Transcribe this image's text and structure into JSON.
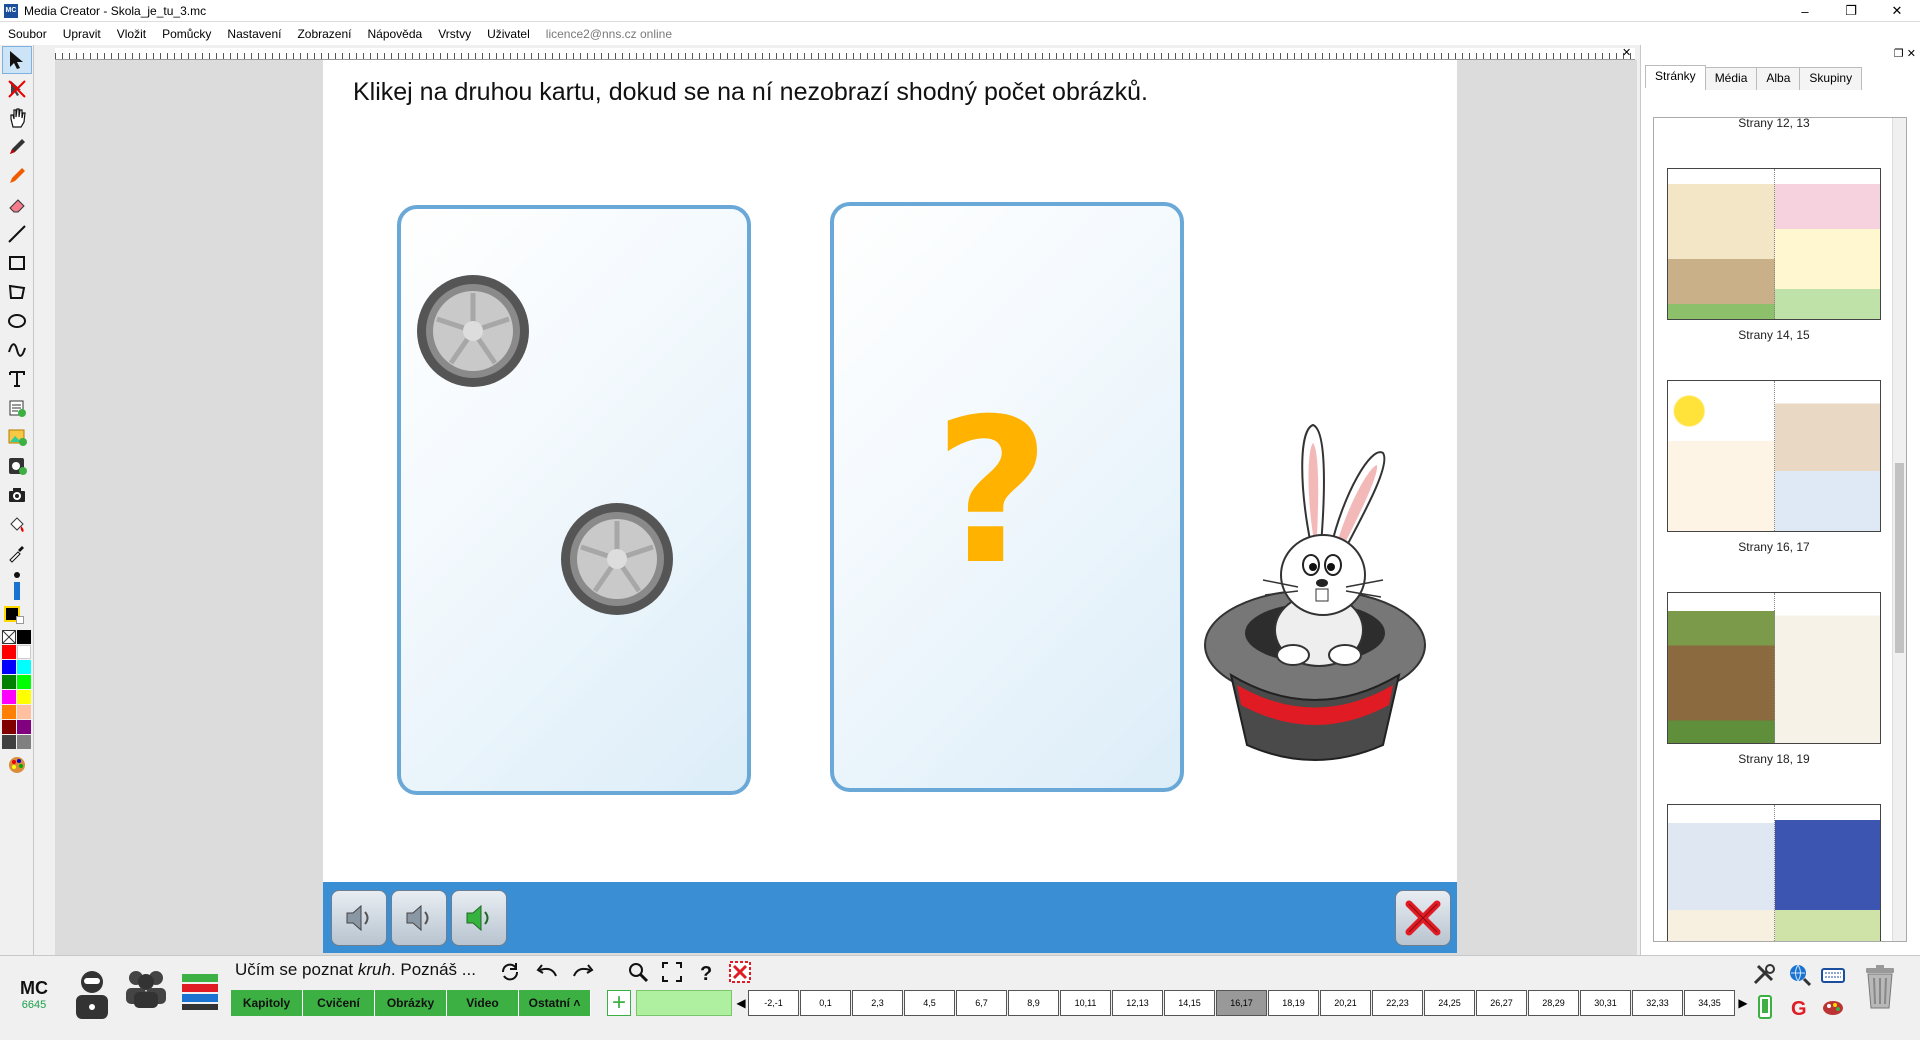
{
  "window": {
    "title": "Media Creator - Skola_je_tu_3.mc",
    "app_icon": "MC"
  },
  "menu": {
    "items": [
      "Soubor",
      "Upravit",
      "Vložit",
      "Pomůcky",
      "Nastavení",
      "Zobrazení",
      "Nápověda",
      "Vrstvy",
      "Uživatel"
    ],
    "user_status": "licence2@nns.cz online"
  },
  "toolbox": {
    "tools": [
      "select-arrow-icon",
      "no-select-icon",
      "hand-icon",
      "pen-icon",
      "highlighter-icon",
      "eraser-icon",
      "line-icon",
      "rectangle-icon",
      "polygon-icon",
      "ellipse-icon",
      "curve-icon",
      "text-icon",
      "note-icon",
      "image-icon",
      "media-icon",
      "camera-icon",
      "fill-icon",
      "eyedropper-icon"
    ],
    "palette": [
      "#000000",
      "#ffffff",
      "#ff0000",
      "#ffffff",
      "#0000ff",
      "#00ffff",
      "#008000",
      "#00ff00",
      "#ff00ff",
      "#ffff00",
      "#ff8000",
      "#ffc0a0",
      "#800000",
      "#800080",
      "#404040",
      "#808080"
    ],
    "current_color": "#000000",
    "accent_color": "#ffd800"
  },
  "page": {
    "instruction": "Klikej na druhou kartu, dokud se na ní nezobrazí shodný počet obrázků.",
    "question_mark": "?",
    "card_border": "#6aa8d8",
    "question_color": "#ffb300"
  },
  "panel": {
    "tabs": [
      "Stránky",
      "Média",
      "Alba",
      "Skupiny"
    ],
    "active_tab": "Stránky",
    "pages": [
      {
        "label": "Strany 12, 13"
      },
      {
        "label": "Strany 14, 15"
      },
      {
        "label": "Strany 16, 17"
      },
      {
        "label": "Strany 18, 19"
      }
    ]
  },
  "bottom": {
    "logo": "MC",
    "logo_number": "6645",
    "book_title_prefix": "Učím se poznat ",
    "book_title_italic": "kruh",
    "book_title_suffix": ". Poznáš ...",
    "chapter_tabs": [
      "Kapitoly",
      "Cvičení",
      "Obrázky",
      "Video",
      "Ostatní ˄"
    ],
    "add_label": "+",
    "pages": [
      "-2,-1",
      "0,1",
      "2,3",
      "4,5",
      "6,7",
      "8,9",
      "10,11",
      "12,13",
      "14,15",
      "16,17",
      "18,19",
      "20,21",
      "22,23",
      "24,25",
      "26,27",
      "28,29",
      "30,31",
      "32,33",
      "34,35"
    ],
    "current_page": "16,17",
    "accent_green": "#3cb043"
  }
}
